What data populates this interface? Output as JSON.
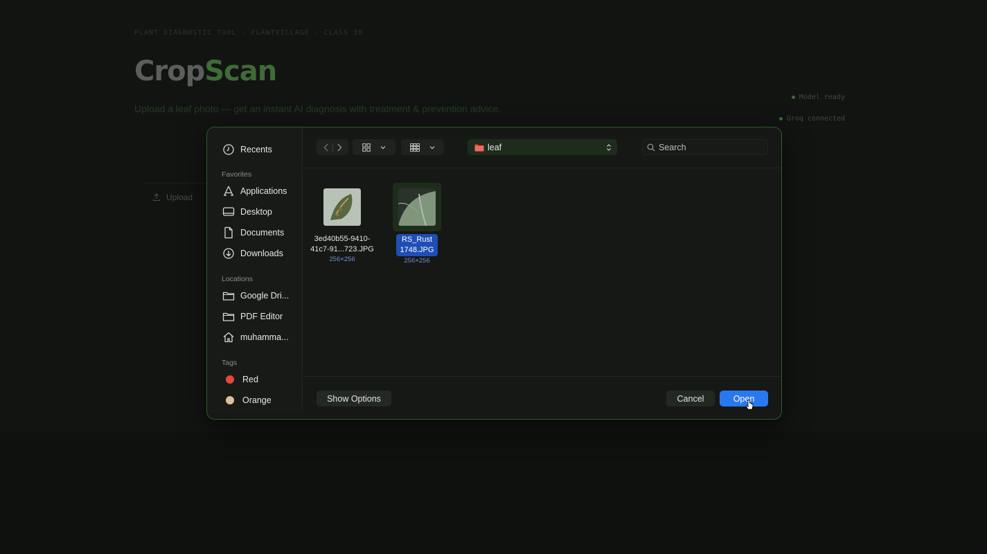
{
  "app": {
    "eyebrow": "PLANT DIAGNOSTIC TOOL  ·  PLANTVILLAGE  ·  CLASS 38",
    "brand_part1": "Crop",
    "brand_part2": "Scan",
    "tagline": "Upload a leaf photo — get an instant AI diagnosis with treatment & prevention advice.",
    "status_model": "Model ready",
    "status_groq": "Groq connected",
    "upload_tab": "Upload"
  },
  "dialog": {
    "sidebar": {
      "recents": "Recents",
      "favorites_header": "Favorites",
      "favorites": [
        "Applications",
        "Desktop",
        "Documents",
        "Downloads"
      ],
      "locations_header": "Locations",
      "locations": [
        "Google Dri...",
        "PDF Editor",
        "muhamma..."
      ],
      "tags_header": "Tags",
      "tags": [
        {
          "label": "Red",
          "color": "#e5483c"
        },
        {
          "label": "Orange",
          "color": "#d8c39a"
        }
      ]
    },
    "path": "leaf",
    "search_placeholder": "Search",
    "files": [
      {
        "name": "3ed40b55-9410-41c7-91...723.JPG",
        "dims": "256×256",
        "selected": false
      },
      {
        "name": "RS_Rust 1748.JPG",
        "dims": "256×256",
        "selected": true
      }
    ],
    "show_options": "Show Options",
    "cancel": "Cancel",
    "open": "Open"
  },
  "colors": {
    "accent_green": "#3f6b38",
    "open_blue": "#2a78f0",
    "selection_blue": "#1f4fb5"
  }
}
